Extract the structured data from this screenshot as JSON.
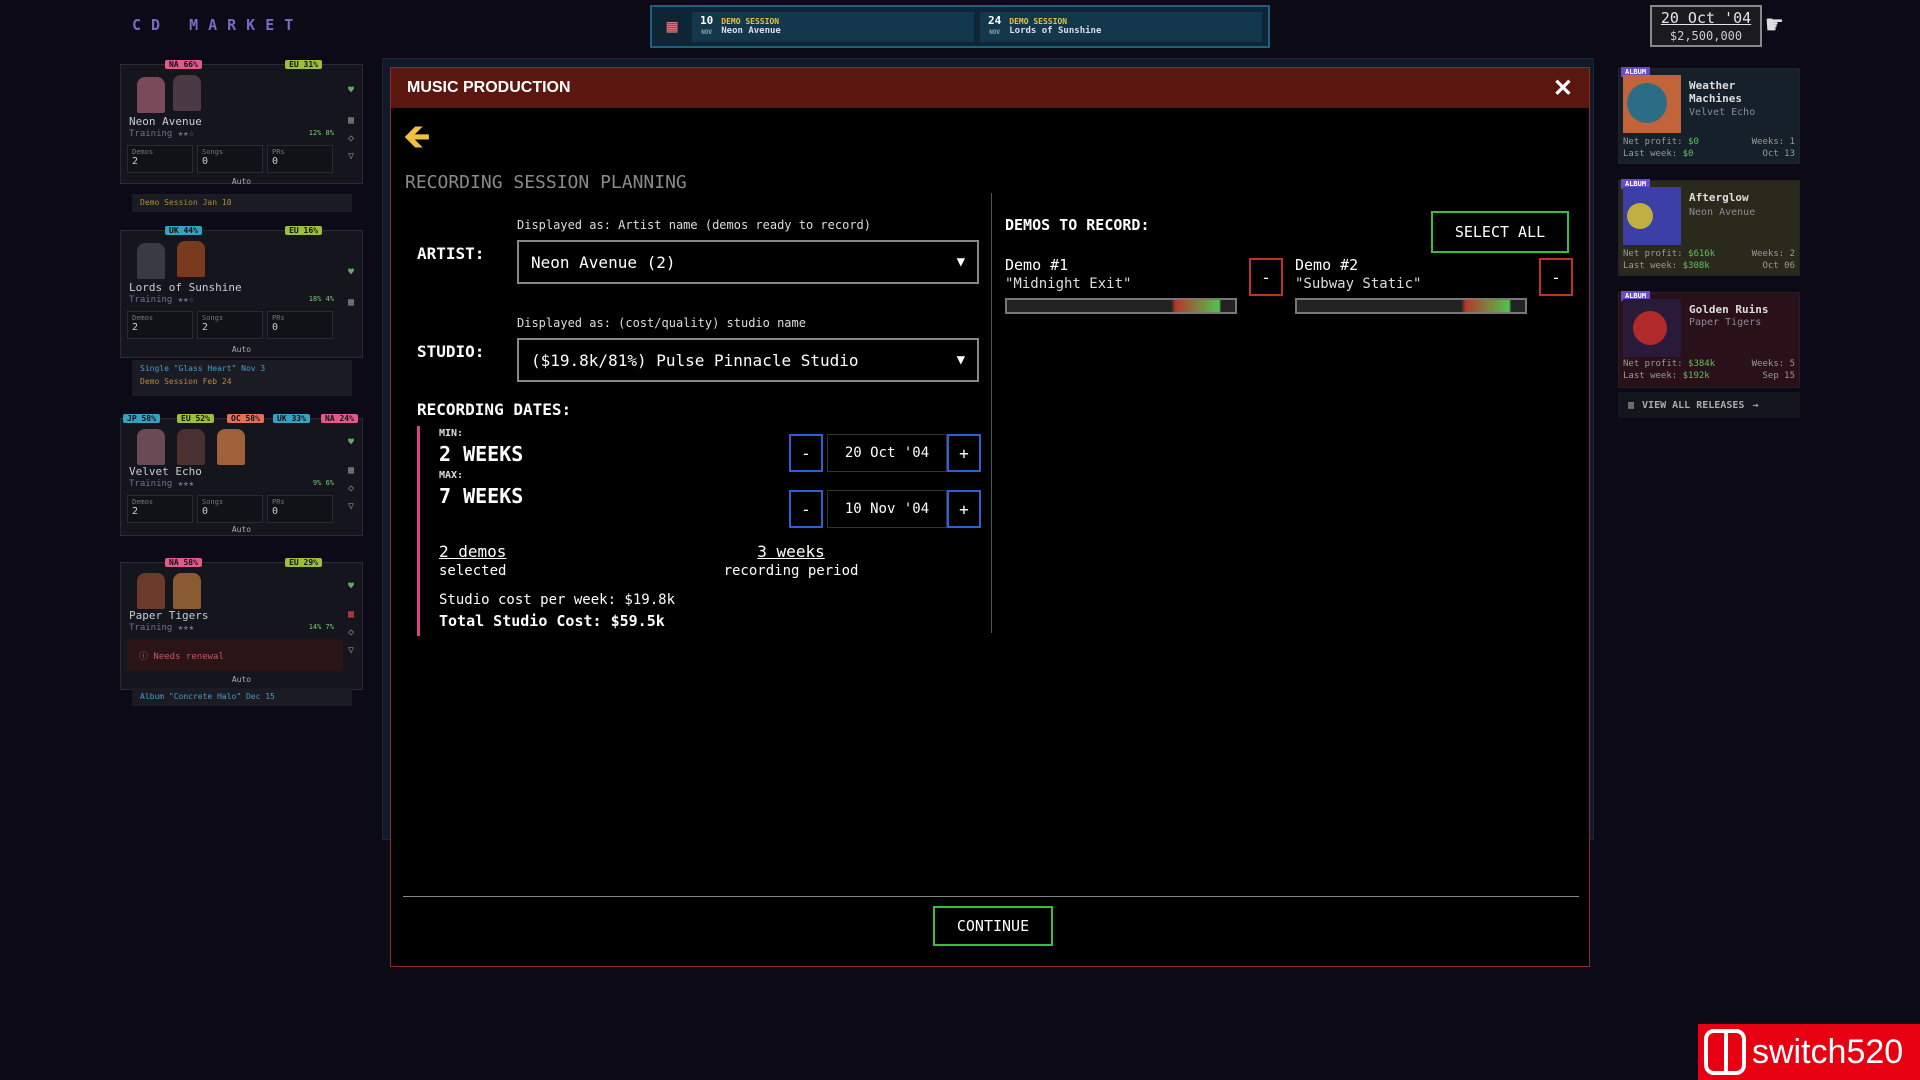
{
  "app": {
    "logo": "CD MARKET"
  },
  "schedule": [
    {
      "day": "10",
      "mon": "NOV",
      "type": "DEMO SESSION",
      "name": "Neon Avenue"
    },
    {
      "day": "24",
      "mon": "NOV",
      "type": "DEMO SESSION",
      "name": "Lords of Sunshine"
    }
  ],
  "clock": {
    "date": "20 Oct '04",
    "money": "$2,500,000"
  },
  "artists": [
    {
      "name": "Neon Avenue",
      "training": "Training ★★☆",
      "tags": [
        "NA 66%",
        "EU 31%"
      ],
      "chips": "12%  8%",
      "demos": "2",
      "songs": "0",
      "prs": "0",
      "auto": "Auto",
      "note": "Demo Session Jan 10"
    },
    {
      "name": "Lords of Sunshine",
      "training": "Training ★★☆",
      "tags": [
        "UK 44%",
        "EU 16%"
      ],
      "chips": "18%  4%",
      "demos": "2",
      "songs": "2",
      "prs": "0",
      "auto": "Auto",
      "note": "Single \"Glass Heart\" Nov 3",
      "note2": "Demo Session Feb 24"
    },
    {
      "name": "Velvet Echo",
      "training": "Training ★★★",
      "tags": [
        "JP 58%",
        "EU 52%",
        "OC 58%",
        "UK 33%",
        "NA 24%"
      ],
      "chips": "9%  6%",
      "demos": "2",
      "songs": "0",
      "prs": "0",
      "auto": "Auto"
    },
    {
      "name": "Paper Tigers",
      "training": "Training ★★★",
      "tags": [
        "NA 58%",
        "EU 29%"
      ],
      "chips": "14%  7%",
      "renewal": "Needs renewal",
      "auto": "Auto",
      "note": "Album \"Concrete Halo\" Dec 15"
    }
  ],
  "stat_labels": {
    "demos": "Demos",
    "songs": "Songs",
    "prs": "PRs"
  },
  "releases": [
    {
      "badge": "ALBUM",
      "title": "Weather Machines",
      "artist": "Velvet Echo",
      "profit_label": "Net profit:",
      "profit": "$0",
      "weeks": "Weeks: 1",
      "last_label": "Last week:",
      "last": "$0",
      "date": "Oct 13",
      "color": "#2a6d84"
    },
    {
      "badge": "ALBUM",
      "title": "Afterglow",
      "artist": "Neon Avenue",
      "profit_label": "Net profit:",
      "profit": "$616k",
      "weeks": "Weeks: 2",
      "last_label": "Last week:",
      "last": "$308k",
      "date": "Oct 06",
      "color": "#3b3fa6"
    },
    {
      "badge": "ALBUM",
      "title": "Golden Ruins",
      "artist": "Paper Tigers",
      "profit_label": "Net profit:",
      "profit": "$384k",
      "weeks": "Weeks: 5",
      "last_label": "Last week:",
      "last": "$192k",
      "date": "Sep 15",
      "color": "#7a1a2a"
    }
  ],
  "view_all": "VIEW ALL RELEASES",
  "modal": {
    "title": "MUSIC PRODUCTION",
    "close": "✕",
    "section": "RECORDING SESSION PLANNING",
    "artist_label": "ARTIST:",
    "artist_hint": "Displayed as: Artist name (demos ready to record)",
    "artist_value": "Neon Avenue (2)",
    "studio_label": "STUDIO:",
    "studio_hint": "Displayed as: (cost/quality) studio name",
    "studio_value": "($19.8k/81%) Pulse Pinnacle Studio",
    "dates_label": "RECORDING DATES:",
    "min_label": "MIN:",
    "min_value": "2 WEEKS",
    "max_label": "MAX:",
    "max_value": "7 WEEKS",
    "start_date": "20 Oct '04",
    "end_date": "10 Nov '04",
    "minus": "-",
    "plus": "+",
    "demos_selected": "2 demos",
    "demos_selected_label": "selected",
    "weeks_value": "3 weeks",
    "weeks_label": "recording period",
    "cost_week": "Studio cost per week: $19.8k",
    "cost_total": "Total Studio Cost: $59.5k",
    "demos_header": "DEMOS TO RECORD:",
    "select_all": "SELECT ALL",
    "demos": [
      {
        "name": "Demo #1",
        "title": "\"Midnight Exit\"",
        "remove": "-"
      },
      {
        "name": "Demo #2",
        "title": "\"Subway Static\"",
        "remove": "-"
      }
    ],
    "continue": "CONTINUE"
  },
  "watermark": "switch520"
}
